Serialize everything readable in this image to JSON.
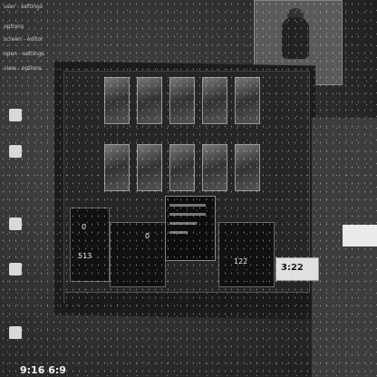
{
  "topbar": {
    "lines": [
      "user - settings",
      "options",
      "screen - editor",
      "open - settings",
      "view - options"
    ]
  },
  "stats": {
    "left_value": "0",
    "left_value2": "513",
    "mid_value": "0",
    "right_value": "122"
  },
  "score": "3:22",
  "bottom_label": "9:16 6:9",
  "colors": {
    "bg": "#3a3a3a",
    "panel": "#262626",
    "text": "#dddddd"
  }
}
